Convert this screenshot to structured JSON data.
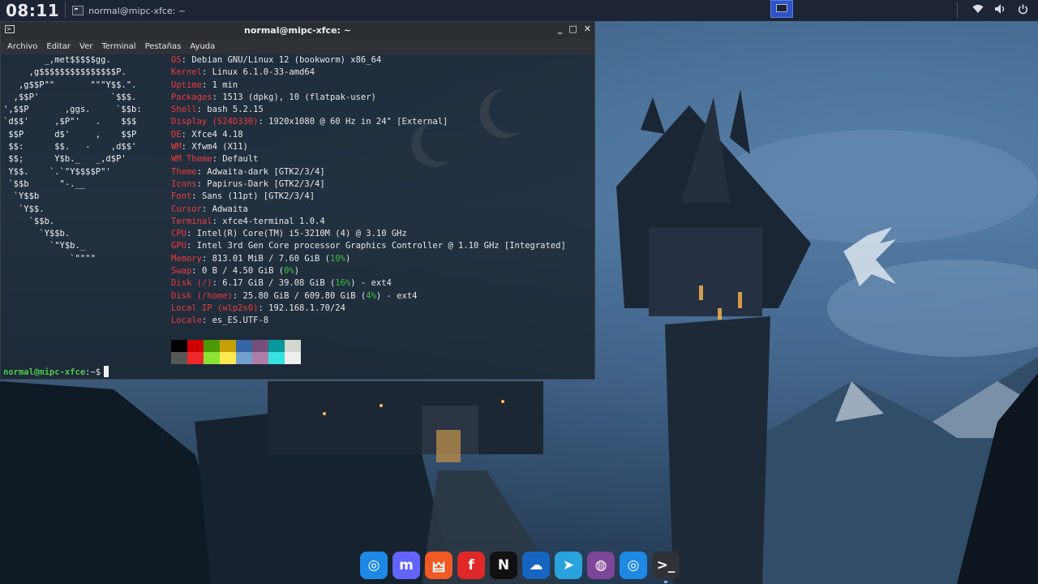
{
  "top_panel": {
    "clock": "08:11",
    "task_title": "normal@mipc-xfce: ~"
  },
  "window": {
    "title": "normal@mipc-xfce: ~",
    "controls": [
      "_",
      "□",
      "✕"
    ],
    "menu": [
      "Archivo",
      "Editar",
      "Ver",
      "Terminal",
      "Pestañas",
      "Ayuda"
    ]
  },
  "terminal": {
    "logo": [
      "        _,met$$$$$gg.",
      "     ,g$$$$$$$$$$$$$$$P.",
      "   ,g$$P\"\"       \"\"\"Y$$.\".",
      "  ,$$P'              `$$$.",
      "',$$P       ,ggs.     `$$b:",
      "`d$$'     ,$P\"'   .    $$$",
      " $$P      d$'     ,    $$P",
      " $$:      $$.   -    ,d$$'",
      " $$;      Y$b._   _,d$P'",
      " Y$$.    `.`\"Y$$$$P\"'",
      " `$$b      \"-.__",
      "  `Y$$b",
      "   `Y$$.",
      "     `$$b.",
      "       `Y$$b.",
      "         `\"Y$b._",
      "             `\"\"\"\""
    ],
    "info": [
      {
        "key": "OS",
        "value": "Debian GNU/Linux 12 (bookworm) x86_64"
      },
      {
        "key": "Kernel",
        "value": "Linux 6.1.0-33-amd64"
      },
      {
        "key": "Uptime",
        "value": "1 min"
      },
      {
        "key": "Packages",
        "value": "1513 (dpkg), 10 (flatpak-user)"
      },
      {
        "key": "Shell",
        "value": "bash 5.2.15"
      },
      {
        "key": "Display (S24D330)",
        "value": "1920x1080 @ 60 Hz in 24\" [External]"
      },
      {
        "key": "DE",
        "value": "Xfce4 4.18"
      },
      {
        "key": "WM",
        "value": "Xfwm4 (X11)"
      },
      {
        "key": "WM Theme",
        "value": "Default"
      },
      {
        "key": "Theme",
        "value": "Adwaita-dark [GTK2/3/4]"
      },
      {
        "key": "Icons",
        "value": "Papirus-Dark [GTK2/3/4]"
      },
      {
        "key": "Font",
        "value": "Sans (11pt) [GTK2/3/4]"
      },
      {
        "key": "Cursor",
        "value": "Adwaita"
      },
      {
        "key": "Terminal",
        "value": "xfce4-terminal 1.0.4"
      },
      {
        "key": "CPU",
        "value": "Intel(R) Core(TM) i5-3210M (4) @ 3.10 GHz"
      },
      {
        "key": "GPU",
        "value": "Intel 3rd Gen Core processor Graphics Controller @ 1.10 GHz [Integrated]"
      },
      {
        "key": "Memory",
        "pre": "813.01 MiB / 7.60 GiB (",
        "pct": "10%",
        "post": ")"
      },
      {
        "key": "Swap",
        "pre": "0 B / 4.50 GiB (",
        "pct": "0%",
        "post": ")"
      },
      {
        "key": "Disk (/)",
        "pre": "6.17 GiB / 39.08 GiB (",
        "pct": "16%",
        "post": ") - ext4"
      },
      {
        "key": "Disk (/home)",
        "pre": "25.80 GiB / 609.80 GiB (",
        "pct": "4%",
        "post": ") - ext4"
      },
      {
        "key": "Local IP (wlp2s0)",
        "value": "192.168.1.70/24"
      },
      {
        "key": "Locale",
        "value": "es_ES.UTF-8"
      }
    ],
    "palette_top": [
      "#000000",
      "#cc0000",
      "#4e9a06",
      "#c4a000",
      "#3465a4",
      "#75507b",
      "#06989a",
      "#d3d7cf"
    ],
    "palette_bottom": [
      "#555753",
      "#ef2929",
      "#8ae234",
      "#fce94f",
      "#729fcf",
      "#ad7fa8",
      "#34e2e2",
      "#eeeeec"
    ],
    "prompt_user": "normal@mipc-xfce",
    "prompt_rest": ":~$"
  },
  "dock": {
    "items": [
      {
        "name": "safari-like-browser-icon",
        "glyph": "◎",
        "color": "#1e88e5"
      },
      {
        "name": "mastodon-icon",
        "glyph": "m",
        "color": "#6364ff"
      },
      {
        "name": "brave-browser-icon",
        "glyph": "🜲",
        "color": "#f15a24"
      },
      {
        "name": "flipboard-icon",
        "glyph": "f",
        "color": "#e12828"
      },
      {
        "name": "netflix-icon",
        "glyph": "N",
        "color": "#111111"
      },
      {
        "name": "weather-app-icon",
        "glyph": "☁",
        "color": "#1565c0"
      },
      {
        "name": "telegram-icon",
        "glyph": "➤",
        "color": "#2aa3dd"
      },
      {
        "name": "tor-browser-icon",
        "glyph": "◍",
        "color": "#7d4698"
      },
      {
        "name": "web-browser-icon",
        "glyph": "◎",
        "color": "#1e88e5"
      },
      {
        "name": "terminal-app-icon",
        "glyph": ">_",
        "color": "#2f3237"
      }
    ]
  }
}
